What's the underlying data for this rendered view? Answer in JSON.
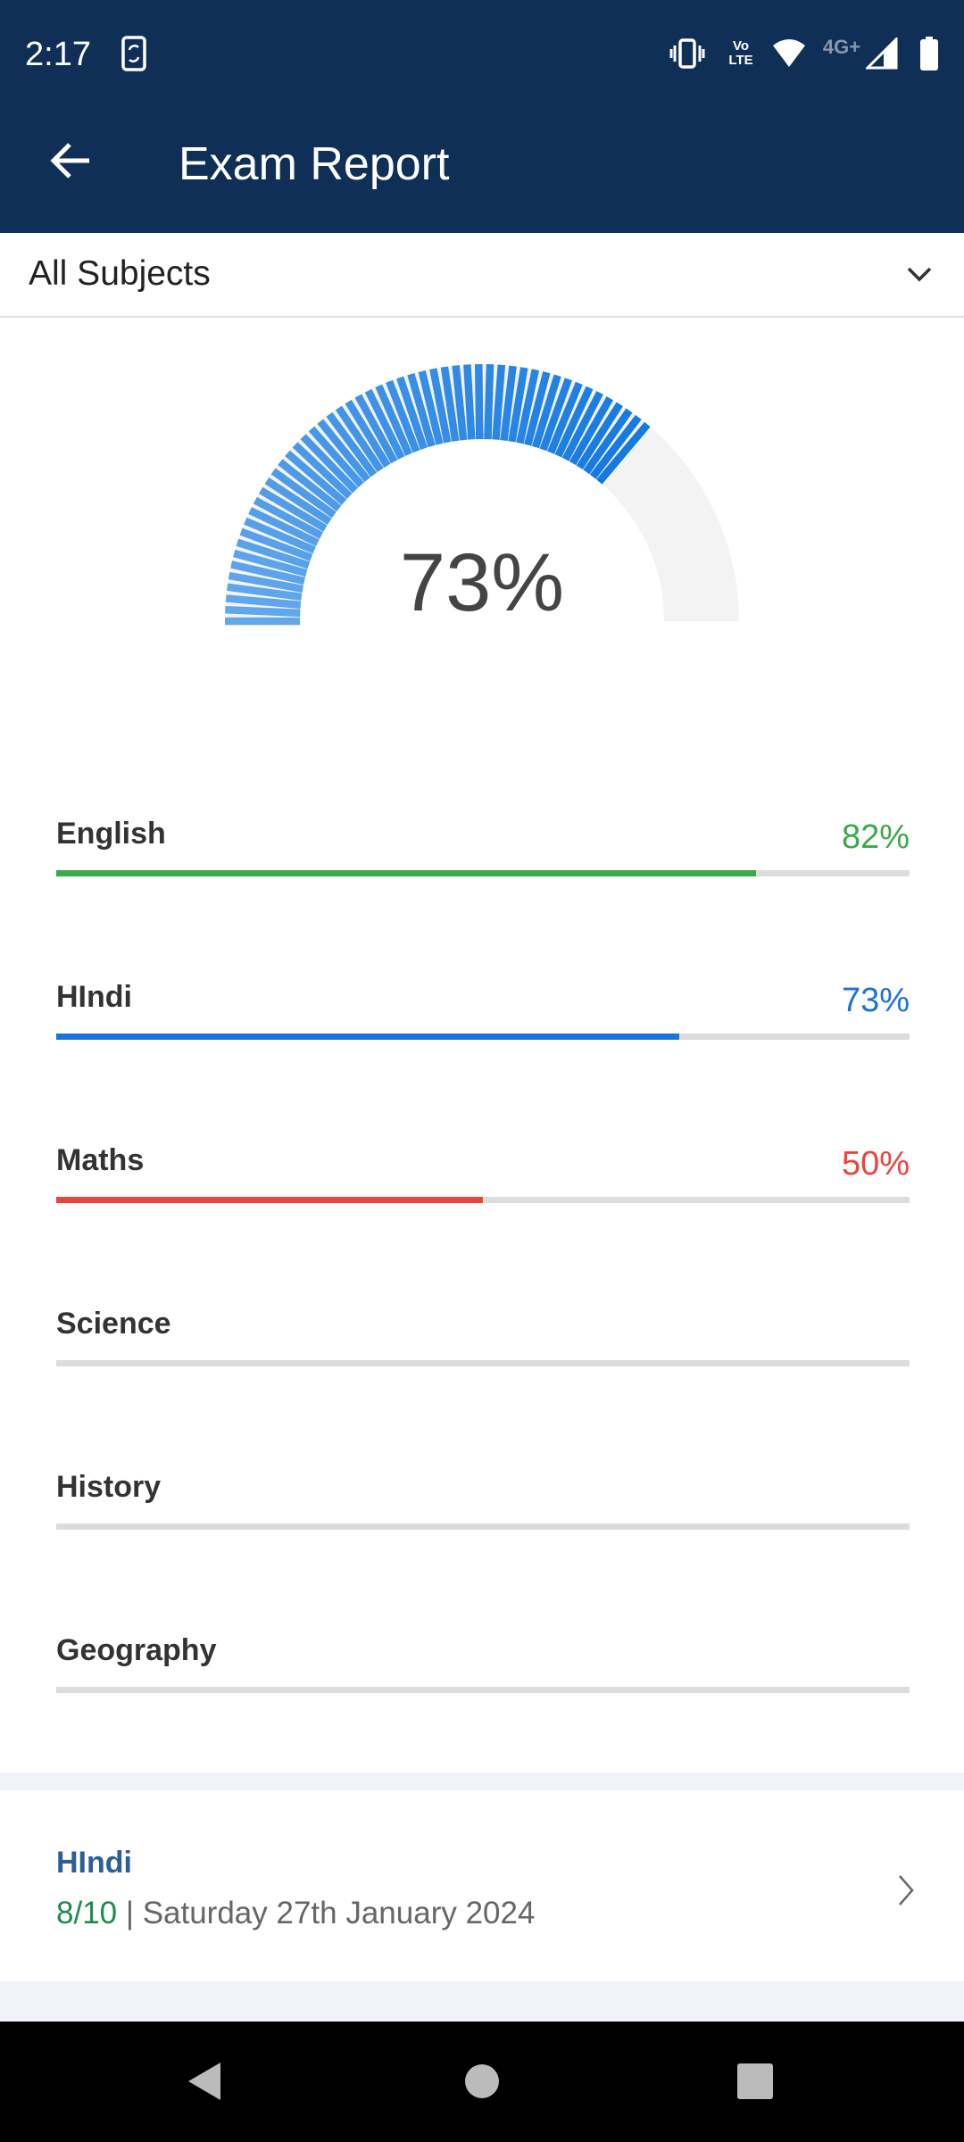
{
  "status_bar": {
    "time": "2:17",
    "network": "4G+",
    "icons": [
      "screen-rotate-icon",
      "vibrate-icon",
      "volte-icon",
      "wifi-icon",
      "signal-icon",
      "battery-icon"
    ],
    "volte_text": "Vo LTE"
  },
  "app_bar": {
    "title": "Exam Report",
    "back_icon": "arrow-left-icon"
  },
  "filter": {
    "selected": "All Subjects"
  },
  "overall": {
    "percent_label": "73%",
    "value": 73,
    "fill_color_start": "#64a8ec",
    "fill_color_end": "#1479e0",
    "track_color": "#f3f3f3"
  },
  "subjects": [
    {
      "name": "English",
      "percent_label": "82%",
      "value": 82,
      "color": "#3aaa4a"
    },
    {
      "name": "HIndi",
      "percent_label": "73%",
      "value": 73,
      "color": "#1a73d9"
    },
    {
      "name": "Maths",
      "percent_label": "50%",
      "value": 50,
      "color": "#e8453c"
    },
    {
      "name": "Science",
      "percent_label": "",
      "value": 0,
      "color": "#dcdcdc"
    },
    {
      "name": "History",
      "percent_label": "",
      "value": 0,
      "color": "#dcdcdc"
    },
    {
      "name": "Geography",
      "percent_label": "",
      "value": 0,
      "color": "#dcdcdc"
    }
  ],
  "exams": [
    {
      "subject": "HIndi",
      "score": "8/10",
      "separator": "|",
      "date": "Saturday 27th January 2024"
    }
  ]
}
